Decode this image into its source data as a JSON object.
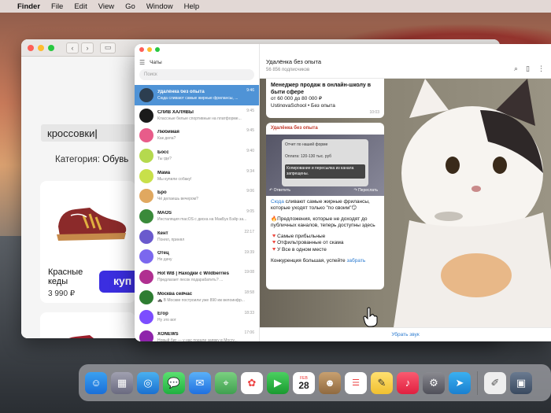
{
  "menubar": {
    "items": [
      "Finder",
      "File",
      "Edit",
      "View",
      "Go",
      "Window",
      "Help"
    ]
  },
  "shop": {
    "search_value": "кроссовки",
    "category_label": "Категория:",
    "category_value": "Обувь",
    "card1_title": "Красные кеды",
    "card1_price": "3 990 ₽",
    "buy_label": "куп"
  },
  "telegram": {
    "chats_header": "Чаты",
    "search_placeholder": "Поиск",
    "chats": [
      {
        "name": "Удалёнка без опыта",
        "preview": "Сюда сливают самые жирные фрилансы, ...",
        "time": "9:46",
        "color": "#2c3e50",
        "active": true
      },
      {
        "name": "СЛИВ ХАЛЯВЫ",
        "preview": "Классные белые спортивные на платформе...",
        "time": "9:45",
        "color": "#1a1a1a",
        "active": false
      },
      {
        "name": "Любимая",
        "preview": "Как дела?",
        "time": "9:45",
        "color": "#e85c8a",
        "active": false
      },
      {
        "name": "Босс",
        "preview": "Ты где?",
        "time": "9:40",
        "color": "#b5d94e",
        "active": false
      },
      {
        "name": "Мама",
        "preview": "Мы купили собаку!",
        "time": "9:34",
        "color": "#c8e04a",
        "active": false
      },
      {
        "name": "Бро",
        "preview": "Чё делаешь вечером?",
        "time": "9:06",
        "color": "#e0a860",
        "active": false
      },
      {
        "name": "MAOS",
        "preview": "Инсталяция macOS с диска на МакБук Бэйр за...",
        "time": "9:05",
        "color": "#3a8a3a",
        "active": false
      },
      {
        "name": "Кент",
        "preview": "Понял, принял",
        "time": "22:17",
        "color": "#6a5acd",
        "active": false
      },
      {
        "name": "Отец",
        "preview": "Не дачу",
        "time": "19:39",
        "color": "#7b68ee",
        "active": false
      },
      {
        "name": "Hot WB | Находки с Wildberries",
        "preview": "Предлагает песок подарабатить? ...",
        "time": "19:08",
        "color": "#b03090",
        "active": false
      },
      {
        "name": "Москва сейчас",
        "preview": "🚓 В Москве построили уже 890 км велоинфр...",
        "time": "18:58",
        "color": "#2e7d32",
        "active": false
      },
      {
        "name": "Егор",
        "preview": "Ну это вот",
        "time": "18:33",
        "color": "#7c4dff",
        "active": false
      },
      {
        "name": "XONEWS",
        "preview": "Новый биг — у нас подали заявку в Мосгу...",
        "time": "17:06",
        "color": "#8e24aa",
        "active": false
      }
    ],
    "channel_name": "Удалёнка без опыта",
    "channel_subs": "56 856 подписчиков",
    "msg1_title": "Менеджер продаж в онлайн-школу в быти сфере",
    "msg1_salary": "от 60 000 до 80 000 ₽",
    "msg1_company": "UstinovaSchool • Без опыта",
    "msg1_time": "10:03",
    "msg2_from": "Удалёнка без опыта",
    "msg2_line1_link": "Сюда",
    "msg2_line1": " сливают самые жирные фрилансы, которые уходят только \"по своим\"😏",
    "msg2_line2": "🔥Предложения, которые не доходят до публичных каналов, теперь доступны здесь",
    "msg2_b1": "🔻Самые прибыльные",
    "msg2_b2": "🔻Отфильтрованные от скама",
    "msg2_b3": "🔻У Все в одном месте",
    "msg2_tail": "Конкуренция большая, успейте ",
    "msg2_tail_link": "забрать",
    "img_text1": "Отчет по нашей форме",
    "img_text2": "Оплата: 120-130 тыс. руб",
    "img_text3": "Копирование и пересылка из канала запрещены.",
    "img_reply": "Ответить",
    "img_forward": "Переслать",
    "sound_label": "Убрать звук"
  },
  "dock": {
    "calendar_month": "FEB",
    "calendar_day": "28"
  }
}
